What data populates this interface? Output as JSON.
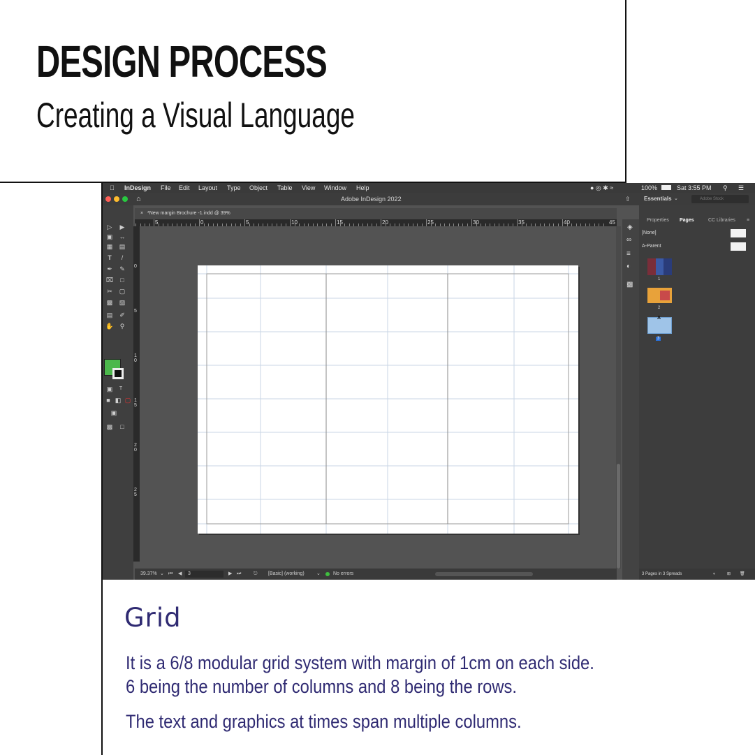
{
  "slide": {
    "title": "DESIGN PROCESS",
    "subtitle": "Creating a Visual Language"
  },
  "app": {
    "menubar": {
      "items": [
        "InDesign",
        "File",
        "Edit",
        "Layout",
        "Type",
        "Object",
        "Table",
        "View",
        "Window",
        "Help"
      ],
      "battery": "100%",
      "clock": "Sat 3:55 PM"
    },
    "window_title": "Adobe InDesign 2022",
    "workspace": "Essentials",
    "search_placeholder": "Adobe Stock",
    "document_tab": "*New margin Brochure -1.indd @ 39%",
    "ruler_h_labels": [
      "5",
      "0",
      "5",
      "10",
      "15",
      "20",
      "25",
      "30",
      "35",
      "40",
      "45"
    ],
    "ruler_v_labels": [
      "0",
      "5",
      "1 0",
      "1 5",
      "2 0",
      "2 5"
    ],
    "status": {
      "zoom": "39.37%",
      "page": "3",
      "style": "[Basic] (working)",
      "preflight": "No errors"
    },
    "panel": {
      "tabs": [
        "Properties",
        "Pages",
        "CC Libraries"
      ],
      "masters": [
        "[None]",
        "A-Parent"
      ],
      "page_numbers": [
        "1",
        "2",
        "3"
      ],
      "master_marker": "A",
      "footer": "3 Pages in 3 Spreads"
    },
    "fill_color": "#4cb84c"
  },
  "content": {
    "heading": "Grid",
    "lines": [
      "It is a 6/8 modular grid system with margin of 1cm on each side.",
      "6 being the number of columns and 8 being the rows.",
      "The text and graphics at times span multiple columns."
    ]
  }
}
